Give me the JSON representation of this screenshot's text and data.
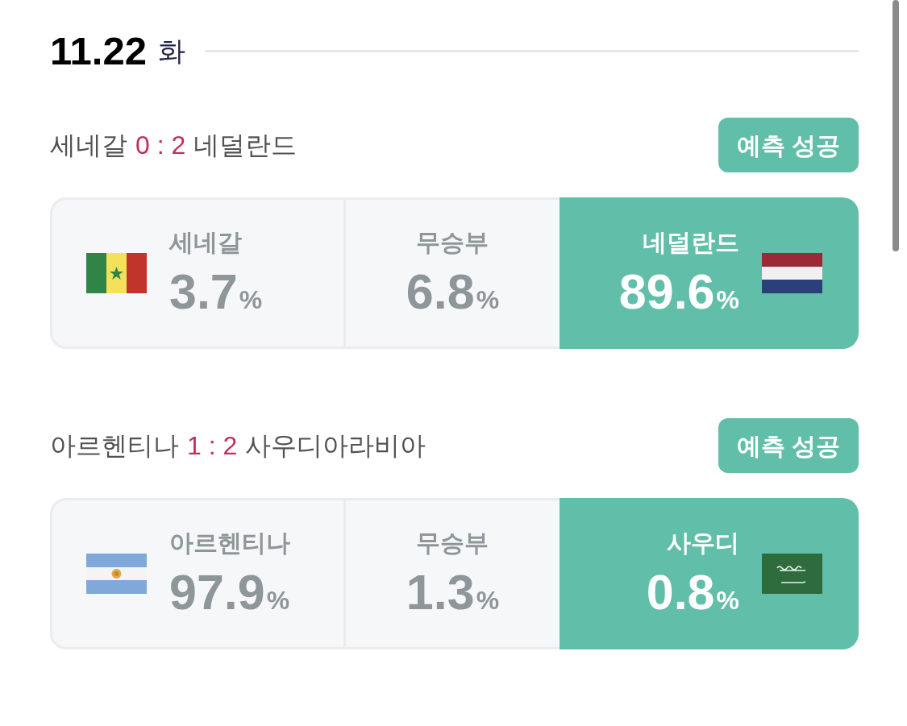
{
  "day": {
    "date": "11.22",
    "weekday": "화"
  },
  "matches": [
    {
      "home": "세네갈",
      "score": "0 : 2",
      "away": "네덜란드",
      "status": "예측 성공",
      "outcomes": [
        {
          "kind": "team",
          "label": "세네갈",
          "flag": {
            "kind": "senegal"
          },
          "value": "3.7",
          "unit": "%",
          "selected": false
        },
        {
          "kind": "draw",
          "label": "무승부",
          "value": "6.8",
          "unit": "%",
          "selected": false
        },
        {
          "kind": "team",
          "label": "네덜란드",
          "flag": {
            "kind": "netherlands"
          },
          "value": "89.6",
          "unit": "%",
          "selected": true
        }
      ]
    },
    {
      "home": "아르헨티나",
      "score": "1 : 2",
      "away": "사우디아라비아",
      "status": "예측 성공",
      "outcomes": [
        {
          "kind": "team",
          "label": "아르헨티나",
          "flag": {
            "kind": "argentina"
          },
          "value": "97.9",
          "unit": "%",
          "selected": false
        },
        {
          "kind": "draw",
          "label": "무승부",
          "value": "1.3",
          "unit": "%",
          "selected": false
        },
        {
          "kind": "team",
          "label": "사우디",
          "flag": {
            "kind": "saudi"
          },
          "value": "0.8",
          "unit": "%",
          "selected": true
        }
      ]
    }
  ]
}
